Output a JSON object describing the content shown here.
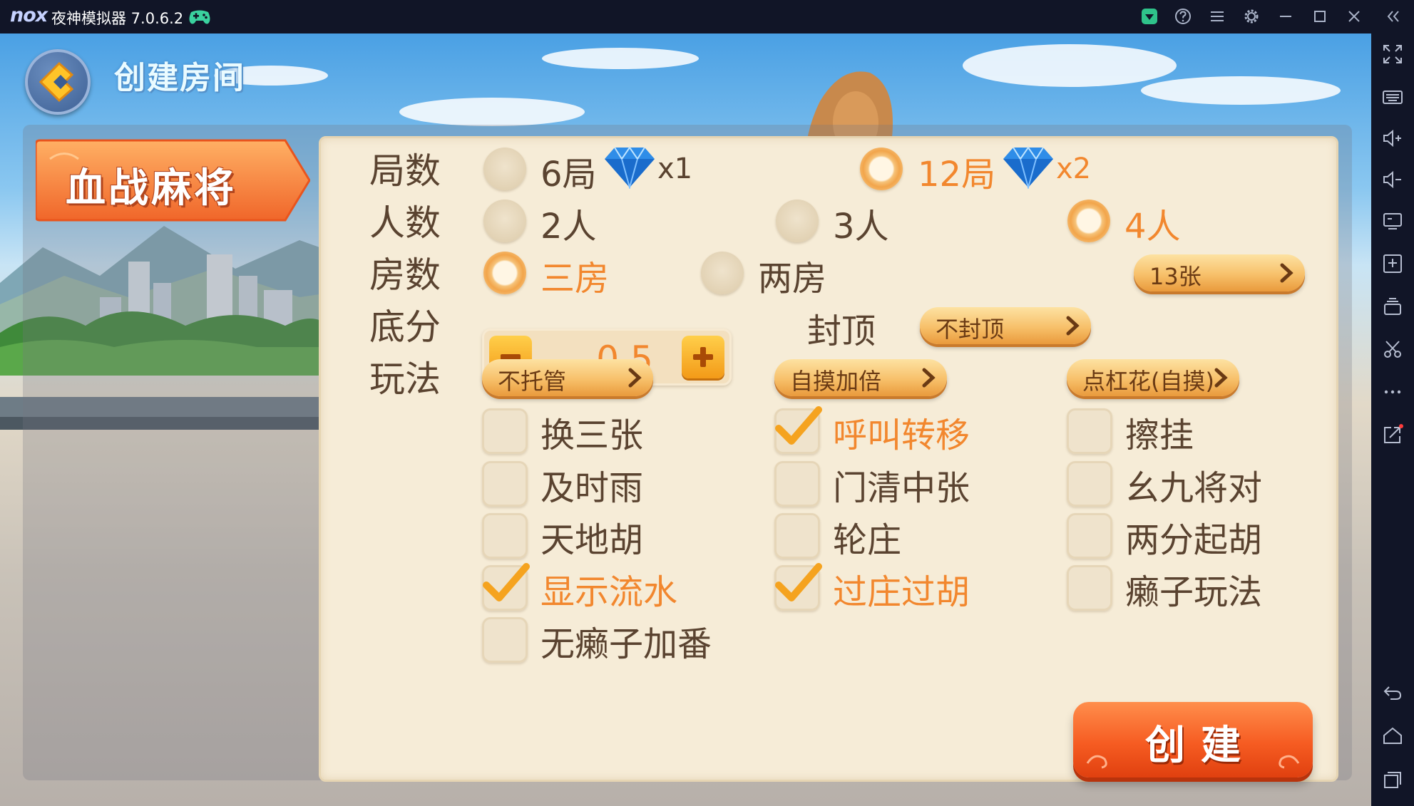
{
  "emulator": {
    "logo": "nox",
    "title": "夜神模拟器 7.0.6.2",
    "title_icons": [
      "gamepad-icon",
      "user-icon",
      "help-icon",
      "menu-icon",
      "settings-icon",
      "minimize-icon",
      "maximize-icon",
      "close-icon",
      "collapse-icon"
    ],
    "sidebar_icons": [
      "fullscreen-icon",
      "keyboard-icon",
      "volume-up-icon",
      "volume-down-icon",
      "screen-icon",
      "apk-install-icon",
      "multi-instance-icon",
      "scissors-icon",
      "more-icon",
      "share-icon",
      "back-icon",
      "home-icon",
      "recent-apps-icon"
    ]
  },
  "header": {
    "title": "创建房间"
  },
  "mode_tab": {
    "label": "血战麻将"
  },
  "rows": {
    "rounds": {
      "label": "局数",
      "options": [
        {
          "label": "6局",
          "cost": "x1",
          "selected": false
        },
        {
          "label": "12局",
          "cost": "x2",
          "selected": true
        }
      ]
    },
    "players": {
      "label": "人数",
      "options": [
        {
          "label": "2人",
          "selected": false
        },
        {
          "label": "3人",
          "selected": false
        },
        {
          "label": "4人",
          "selected": true
        }
      ]
    },
    "rooms": {
      "label": "房数",
      "options": [
        {
          "label": "三房",
          "selected": true
        },
        {
          "label": "两房",
          "selected": false
        }
      ],
      "tiles_selector": "13张"
    },
    "base_score": {
      "label": "底分",
      "value": "0.5",
      "cap_label": "封顶",
      "cap_selector": "不封顶"
    },
    "rules": {
      "label": "玩法",
      "selectors": [
        "不托管",
        "自摸加倍",
        "点杠花(自摸)"
      ],
      "checkboxes": [
        {
          "label": "换三张",
          "checked": false
        },
        {
          "label": "呼叫转移",
          "checked": true
        },
        {
          "label": "擦挂",
          "checked": false
        },
        {
          "label": "及时雨",
          "checked": false
        },
        {
          "label": "门清中张",
          "checked": false
        },
        {
          "label": "幺九将对",
          "checked": false
        },
        {
          "label": "天地胡",
          "checked": false
        },
        {
          "label": "轮庄",
          "checked": false
        },
        {
          "label": "两分起胡",
          "checked": false
        },
        {
          "label": "显示流水",
          "checked": true
        },
        {
          "label": "过庄过胡",
          "checked": true
        },
        {
          "label": "癞子玩法",
          "checked": false
        },
        {
          "label": "无癞子加番",
          "checked": false
        }
      ]
    }
  },
  "create_button": {
    "label": "创建"
  },
  "colors": {
    "panel_bg": "#f6ecd7",
    "text_default": "#5a4330",
    "text_selected": "#f2872e",
    "accent_orange": "#f65c22",
    "pill_gold": "#f7c06a",
    "emulator_chrome": "#111527"
  }
}
